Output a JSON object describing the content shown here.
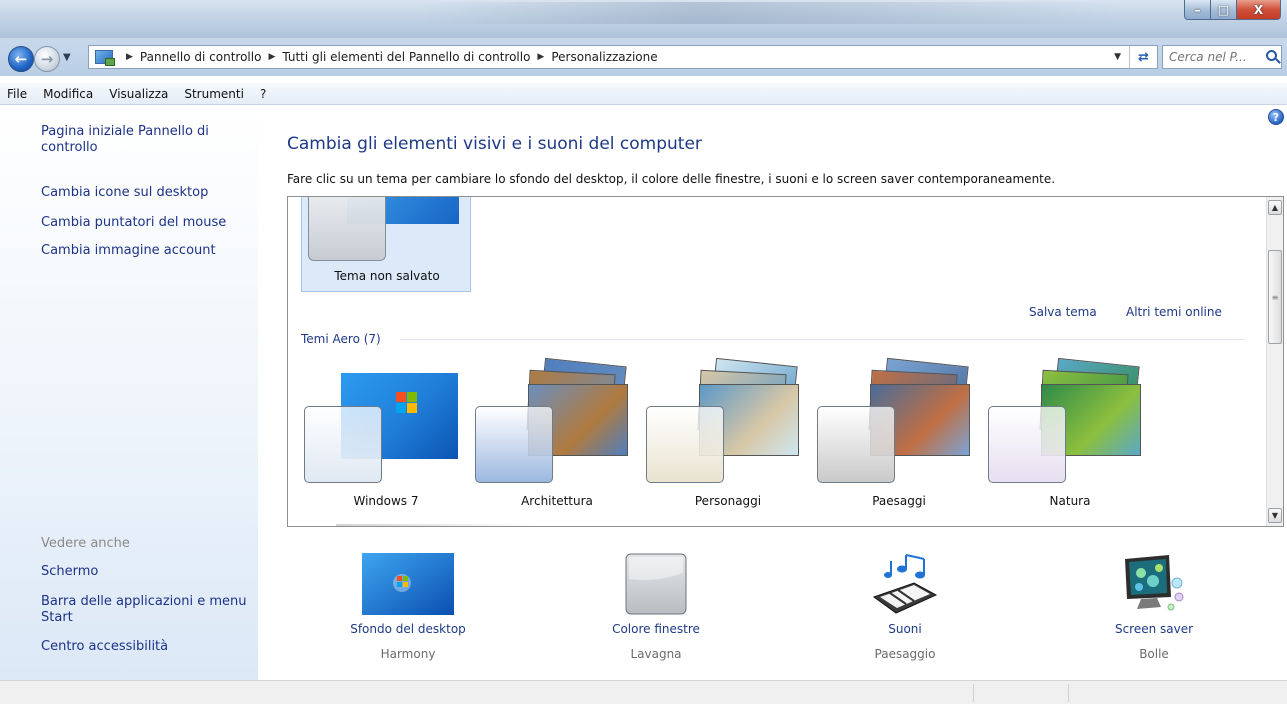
{
  "window": {
    "minimize": "–",
    "maximize": "□",
    "close": "X"
  },
  "address": {
    "crumbs": [
      "Pannello di controllo",
      "Tutti gli elementi del Pannello di controllo",
      "Personalizzazione"
    ]
  },
  "search": {
    "placeholder": "Cerca nel P..."
  },
  "menu": [
    {
      "label": "File"
    },
    {
      "label": "Modifica"
    },
    {
      "label": "Visualizza"
    },
    {
      "label": "Strumenti"
    },
    {
      "label": "?"
    }
  ],
  "left": {
    "links": [
      "Pagina iniziale Pannello di controllo",
      "Cambia icone sul desktop",
      "Cambia puntatori del mouse",
      "Cambia immagine account"
    ],
    "see_also_heading": "Vedere anche",
    "see_also": [
      "Schermo",
      "Barra delle applicazioni e menu Start",
      "Centro accessibilità"
    ]
  },
  "main": {
    "title": "Cambia gli elementi visivi e i suoni del computer",
    "description": "Fare clic su un tema per cambiare lo sfondo del desktop, il colore delle finestre, i suoni e lo screen saver contemporaneamente.",
    "unsaved_theme": "Tema non salvato",
    "save_theme": "Salva tema",
    "more_themes": "Altri temi online",
    "aero_heading": "Temi Aero (7)",
    "themes": [
      {
        "label": "Windows 7",
        "tint": "#dfe8f2",
        "colors": [
          "#1f7dd8",
          "#0c54b4",
          "#2d9cf0"
        ]
      },
      {
        "label": "Architettura",
        "tint": "#9db8e0",
        "colors": [
          "#6a8fbe",
          "#b07a3e",
          "#4f7fbf"
        ]
      },
      {
        "label": "Personaggi",
        "tint": "#e9e3cf",
        "colors": [
          "#5b98c8",
          "#d7c7a6",
          "#cfe6f0"
        ]
      },
      {
        "label": "Paesaggi",
        "tint": "#c9c9c9",
        "colors": [
          "#4b6c98",
          "#c06f44",
          "#7aa4d6"
        ]
      },
      {
        "label": "Natura",
        "tint": "#e6dff0",
        "colors": [
          "#2f8a4a",
          "#8cbf3e",
          "#5aa8c8"
        ]
      }
    ]
  },
  "customize": [
    {
      "title": "Sfondo del desktop",
      "value": "Harmony",
      "icon": "wallpaper-icon"
    },
    {
      "title": "Colore finestre",
      "value": "Lavagna",
      "icon": "window-color-icon"
    },
    {
      "title": "Suoni",
      "value": "Paesaggio",
      "icon": "sounds-icon"
    },
    {
      "title": "Screen saver",
      "value": "Bolle",
      "icon": "screensaver-icon"
    }
  ]
}
